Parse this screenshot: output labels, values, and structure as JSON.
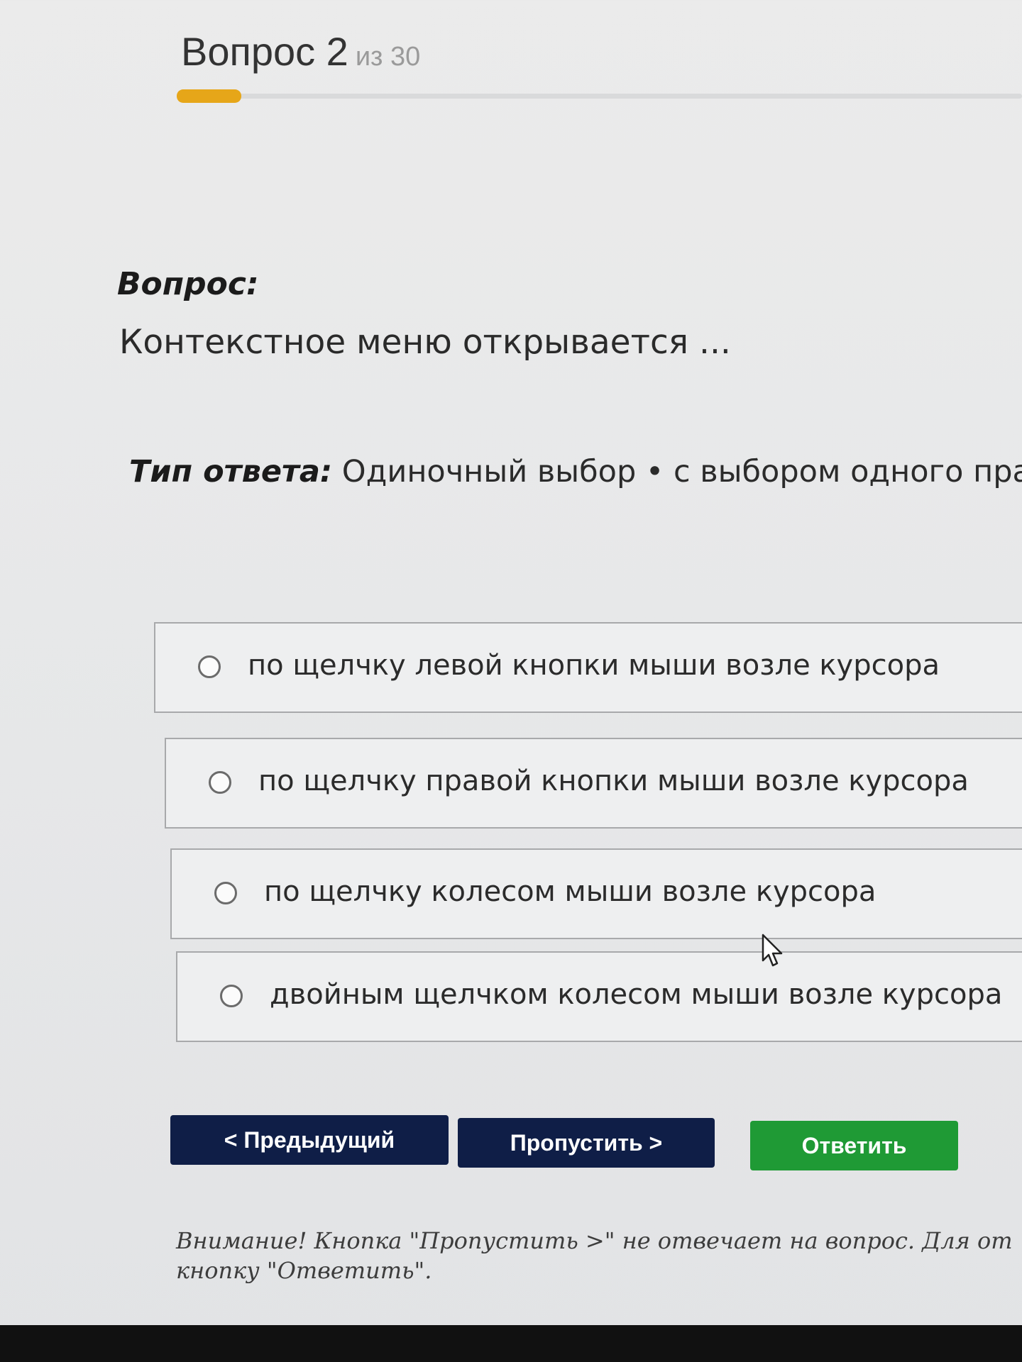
{
  "header": {
    "question_title": "Вопрос 2",
    "question_of": "из 30",
    "progress": 0.067,
    "progress_color": "#e6a619"
  },
  "question": {
    "label": "Вопрос:",
    "text": "Контекстное меню открывается ..."
  },
  "answer_type": {
    "label": "Тип ответа:",
    "value": "Одиночный выбор • с выбором одного прави"
  },
  "options": [
    {
      "label": "по щелчку левой кнопки мыши возле курсора",
      "selected": false
    },
    {
      "label": "по щелчку правой кнопки мыши возле курсора",
      "selected": false
    },
    {
      "label": "по щелчку колесом мыши возле курсора",
      "selected": false
    },
    {
      "label": "двойным щелчком колесом мыши возле курсора",
      "selected": false
    }
  ],
  "buttons": {
    "prev": "< Предыдущий",
    "skip": "Пропустить >",
    "answer": "Ответить",
    "nav_color": "#0f1e47",
    "answer_color": "#1f9a35"
  },
  "warning": {
    "line1": "Внимание! Кнопка \"Пропустить >\" не отвечает на вопрос. Для от",
    "line2": "кнопку \"Ответить\"."
  },
  "icons": {
    "cursor": "mouse-pointer-icon"
  }
}
